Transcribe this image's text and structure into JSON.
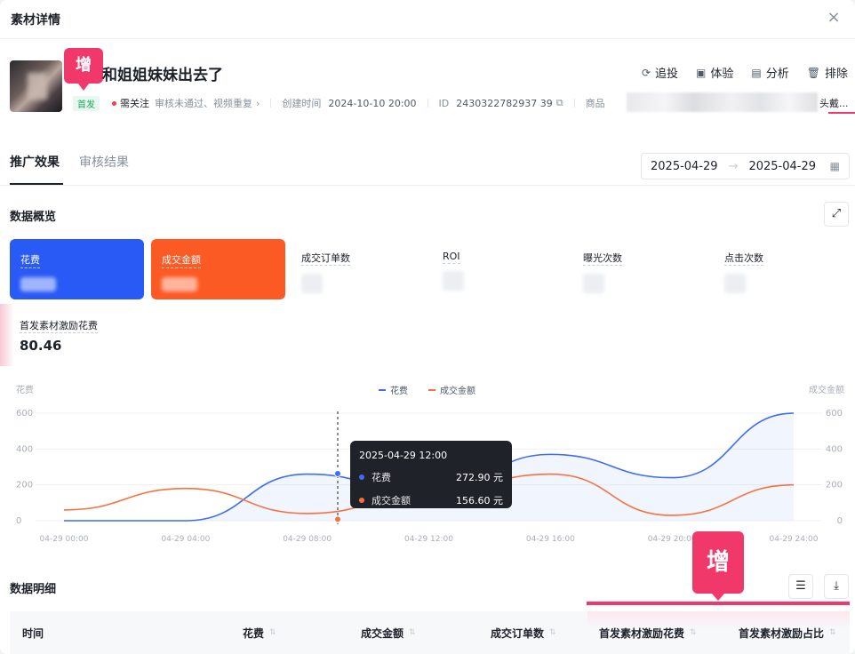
{
  "modal": {
    "title": "素材详情",
    "close": "×"
  },
  "material": {
    "zeng_badge": "增",
    "title": "和姐姐妹妹出去了",
    "status_badge": "首发",
    "status": "需关注",
    "reason": "审核未通过、视频重复",
    "created_label": "创建时间",
    "created_value": "2024-10-10 20:00",
    "id_label": "ID",
    "id_value": "2430322782937 39",
    "product_label": "商品",
    "product_tail": "头戴...",
    "actions": [
      {
        "label": "追投",
        "icon": "refresh-icon"
      },
      {
        "label": "体验",
        "icon": "phone-icon"
      },
      {
        "label": "分析",
        "icon": "analysis-icon"
      },
      {
        "label": "排除",
        "icon": "trash-icon"
      }
    ]
  },
  "tabs": [
    {
      "label": "推广效果"
    },
    {
      "label": "审核结果"
    }
  ],
  "date_range": {
    "start": "2025-04-29",
    "end": "2025-04-29",
    "arrow": "→"
  },
  "overview": {
    "title": "数据概览",
    "cards": [
      {
        "label": "花费"
      },
      {
        "label": "成交金额"
      }
    ],
    "metrics": [
      {
        "label": "成交订单数"
      },
      {
        "label": "ROI"
      },
      {
        "label": "曝光次数"
      },
      {
        "label": "点击次数"
      }
    ],
    "extra": {
      "label": "首发素材激励花费",
      "value": "80.46"
    }
  },
  "chart_data": {
    "type": "line",
    "x": [
      "04-29 00:00",
      "04-29 04:00",
      "04-29 08:00",
      "04-29 12:00",
      "04-29 16:00",
      "04-29 20:00",
      "04-29 24:00"
    ],
    "series": [
      {
        "name": "花费",
        "color": "#3d6cf5",
        "values": [
          0,
          0,
          260,
          150,
          370,
          240,
          600
        ]
      },
      {
        "name": "成交金额",
        "color": "#f9703e",
        "values": [
          60,
          180,
          40,
          150,
          260,
          30,
          200
        ]
      }
    ],
    "ylabel_left": "花费",
    "ylabel_right": "成交金额",
    "yticks": [
      0,
      200,
      400,
      600
    ],
    "ylim": [
      0,
      600
    ],
    "tooltip": {
      "time": "2025-04-29 12:00",
      "rows": [
        {
          "name": "花费",
          "value": "272.90 元",
          "color": "#3d6cf5"
        },
        {
          "name": "成交金额",
          "value": "156.60 元",
          "color": "#f9703e"
        }
      ]
    }
  },
  "detail": {
    "title": "数据明细",
    "zeng_badge": "增",
    "columns": [
      "时间",
      "花费",
      "成交金额",
      "成交订单数",
      "首发素材激励花费",
      "首发素材激励占比"
    ]
  }
}
